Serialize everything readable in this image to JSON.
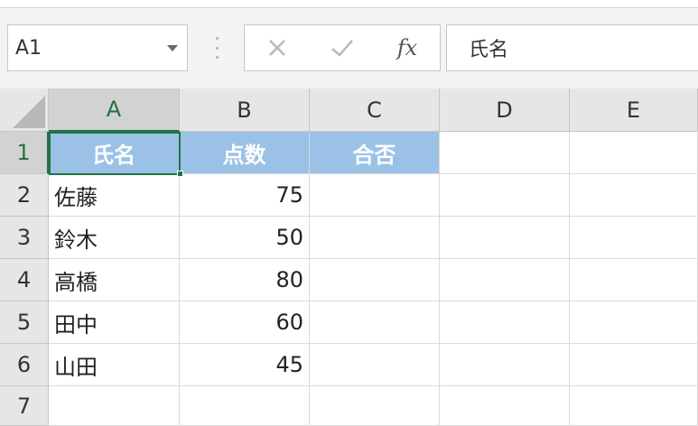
{
  "name_box": {
    "value": "A1"
  },
  "formula_bar": {
    "cancel_icon": "close-icon",
    "enter_icon": "checkmark-icon",
    "function_label": "fx",
    "content": "氏名"
  },
  "colors": {
    "header_fill": "#9bc2e6",
    "selection": "#217346",
    "header_bg": "#e6e6e6"
  },
  "columns": [
    "A",
    "B",
    "C",
    "D",
    "E"
  ],
  "rows": [
    "1",
    "2",
    "3",
    "4",
    "5",
    "6",
    "7"
  ],
  "cells": {
    "A1": "氏名",
    "B1": "点数",
    "C1": "合否",
    "A2": "佐藤",
    "B2": "75",
    "A3": "鈴木",
    "B3": "50",
    "A4": "高橋",
    "B4": "80",
    "A5": "田中",
    "B5": "60",
    "A6": "山田",
    "B6": "45"
  }
}
